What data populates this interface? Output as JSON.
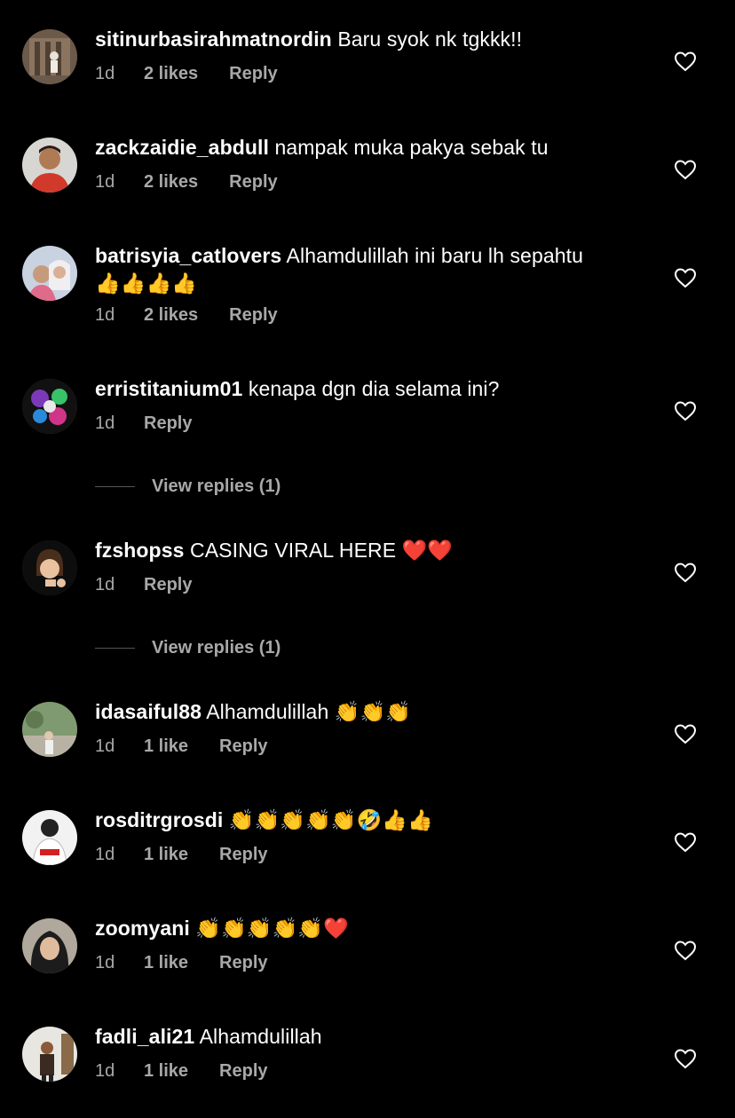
{
  "comments": [
    {
      "username": "sitinurbasirahmatnordin",
      "text": "Baru syok nk tgkkk!!",
      "time": "1d",
      "likes": "2 likes",
      "reply": "Reply"
    },
    {
      "username": "zackzaidie_abdull",
      "text": "nampak muka pakya sebak tu",
      "time": "1d",
      "likes": "2 likes",
      "reply": "Reply"
    },
    {
      "username": "batrisyia_catlovers",
      "text": "Alhamdulillah ini baru lh sepahtu",
      "text2": "👍👍👍👍",
      "time": "1d",
      "likes": "2 likes",
      "reply": "Reply"
    },
    {
      "username": "erristitanium01",
      "text": "kenapa dgn dia selama ini?",
      "time": "1d",
      "reply": "Reply",
      "view_replies": "View replies (1)"
    },
    {
      "username": "fzshopss",
      "text": "CASING VIRAL HERE ❤️❤️",
      "time": "1d",
      "reply": "Reply",
      "view_replies": "View replies (1)"
    },
    {
      "username": "idasaiful88",
      "text": "Alhamdulillah 👏👏👏",
      "time": "1d",
      "likes": "1 like",
      "reply": "Reply"
    },
    {
      "username": "rosditrgrosdi",
      "text": "👏👏👏👏👏🤣👍👍",
      "time": "1d",
      "likes": "1 like",
      "reply": "Reply"
    },
    {
      "username": "zoomyani",
      "text": "👏👏👏👏👏❤️",
      "time": "1d",
      "likes": "1 like",
      "reply": "Reply"
    },
    {
      "username": "fadli_ali21",
      "text": "Alhamdulillah",
      "time": "1d",
      "likes": "1 like",
      "reply": "Reply"
    }
  ],
  "colors": {
    "background": "#000000",
    "text": "#ffffff",
    "meta": "#a8a8a8",
    "heart_outline": "#ffffff"
  },
  "icons": {
    "like": "heart-outline-icon"
  }
}
